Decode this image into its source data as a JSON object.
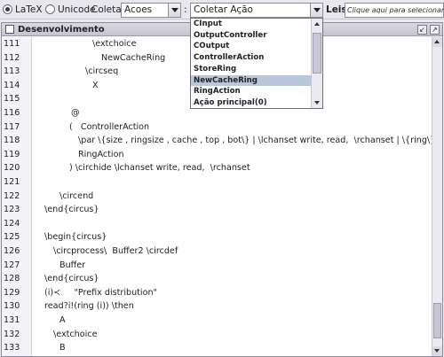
{
  "toolbar": {
    "latex_label": "LaTeX",
    "unicode_label": "Unicode",
    "coletar_label": "Coletar",
    "combo1_value": "Acoes",
    "colon": ":",
    "combo2_value": "Coletar Ação",
    "leis_label": "Leis:",
    "leis_placeholder": "Clique aqui para selecionar a b"
  },
  "window": {
    "title": "Desenvolvimento"
  },
  "popup": {
    "items": [
      "CInput",
      "OutputController",
      "COutput",
      "ControllerAction",
      "StoreRing",
      "NewCacheRing",
      "RingAction",
      "Ação principal(0)"
    ],
    "selected_index": 5
  },
  "editor": {
    "lines": [
      {
        "n": "111",
        "text": "\\extchoice",
        "indent": 64
      },
      {
        "n": "112",
        "text": "NewCacheRing",
        "indent": 74
      },
      {
        "n": "113",
        "text": "\\circseq",
        "indent": 56
      },
      {
        "n": "114",
        "text": "X",
        "indent": 64
      },
      {
        "n": "115",
        "text": "",
        "indent": 0
      },
      {
        "n": "116",
        "text": "@",
        "indent": 40
      },
      {
        "n": "117",
        "text": "(   ControllerAction",
        "indent": 38
      },
      {
        "n": "118",
        "text": "\\par \\{size , ringsize , cache , top , bot\\} | \\lchanset write, read,  \\rchanset | \\{ring\\} \\rpar",
        "indent": 48
      },
      {
        "n": "119",
        "text": "RingAction",
        "indent": 48
      },
      {
        "n": "120",
        "text": ") \\circhide \\lchanset write, read,  \\rchanset",
        "indent": 38
      },
      {
        "n": "121",
        "text": "",
        "indent": 0
      },
      {
        "n": "122",
        "text": "\\circend",
        "indent": 27
      },
      {
        "n": "123",
        "text": "\\end{circus}",
        "indent": 10
      },
      {
        "n": "124",
        "text": "",
        "indent": 0
      },
      {
        "n": "125",
        "text": "\\begin{circus}",
        "indent": 10
      },
      {
        "n": "126",
        "text": "\\circprocess\\  Buffer2 \\circdef",
        "indent": 20
      },
      {
        "n": "127",
        "text": "Buffer",
        "indent": 27
      },
      {
        "n": "128",
        "text": "\\end{circus}",
        "indent": 10
      },
      {
        "n": "129",
        "text": "(i)≺     \"Prefix distribution\"",
        "indent": 10
      },
      {
        "n": "130",
        "text": "read?i!(ring (i)) \\then",
        "indent": 10
      },
      {
        "n": "131",
        "text": "A",
        "indent": 27
      },
      {
        "n": "132",
        "text": "\\extchoice",
        "indent": 20
      },
      {
        "n": "133",
        "text": "B",
        "indent": 27
      }
    ]
  }
}
